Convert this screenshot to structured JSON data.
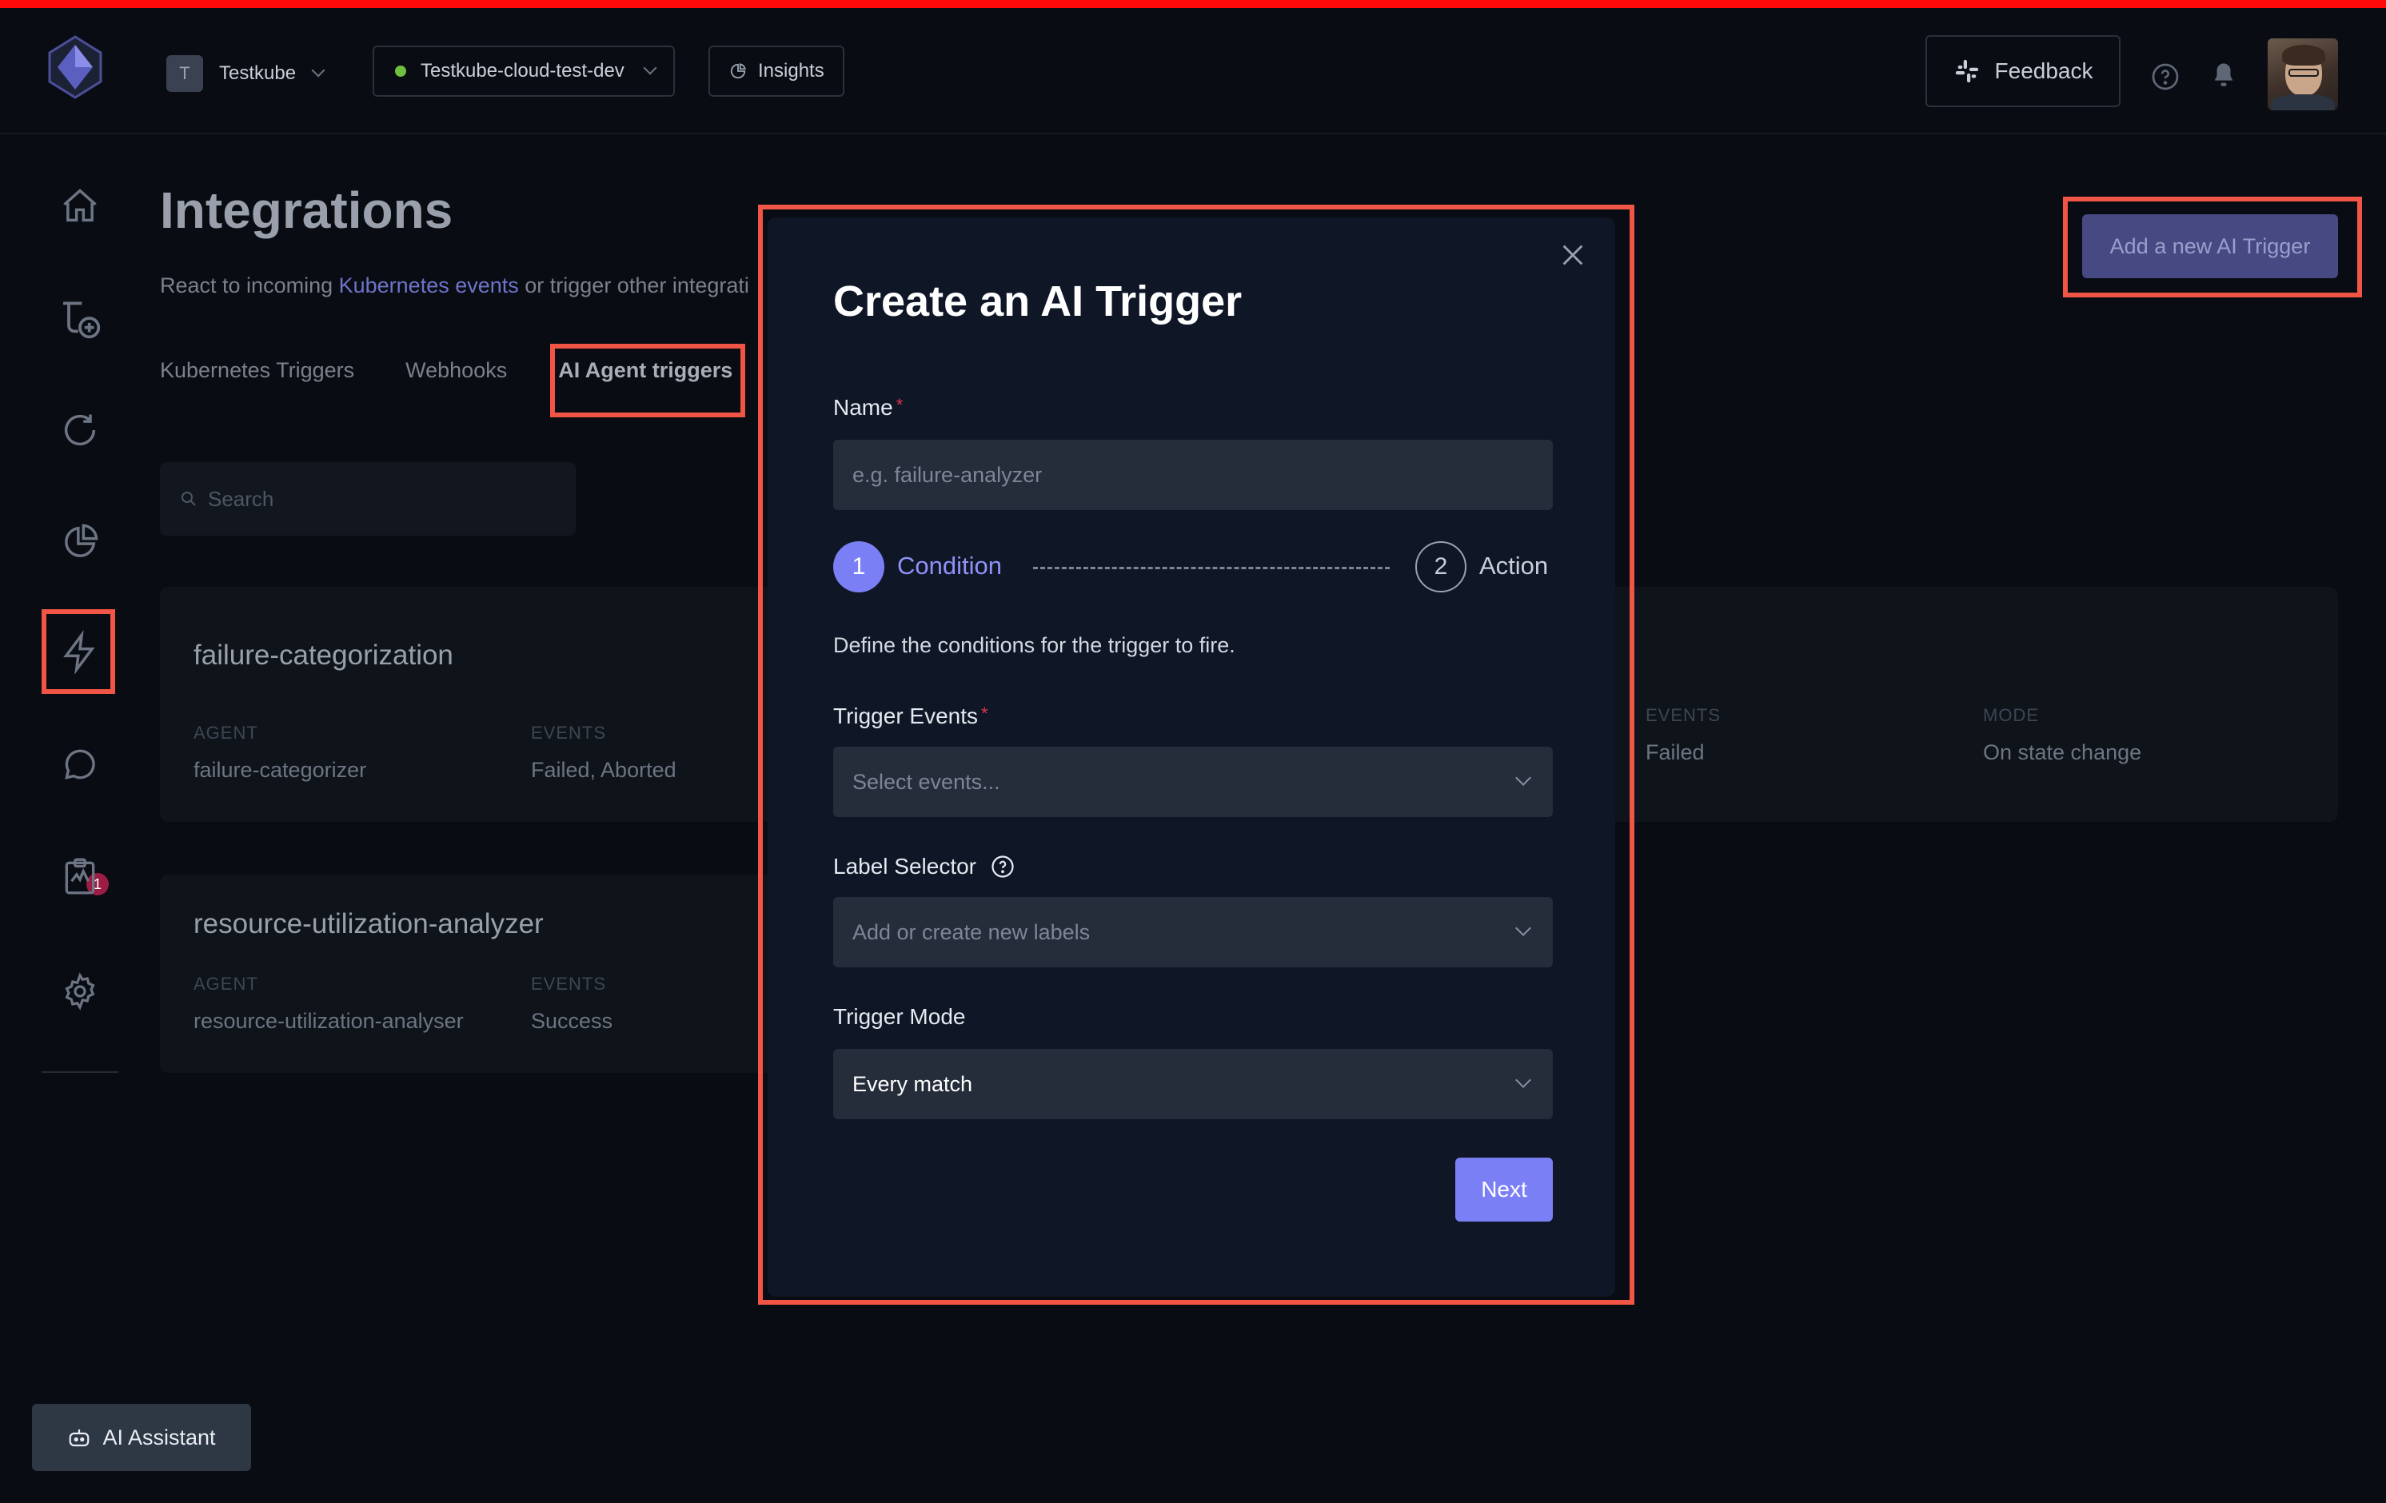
{
  "header": {
    "org": {
      "initial": "T",
      "name": "Testkube"
    },
    "environment": "Testkube-cloud-test-dev",
    "insights_label": "Insights",
    "feedback_label": "Feedback"
  },
  "sidebar": {
    "items": [
      {
        "icon": "home-icon"
      },
      {
        "icon": "add-workflow-icon"
      },
      {
        "icon": "refresh-icon"
      },
      {
        "icon": "pie-chart-icon"
      },
      {
        "icon": "lightning-icon",
        "active": true
      },
      {
        "icon": "chat-icon",
        "badge": "1"
      },
      {
        "icon": "clipboard-chart-icon"
      },
      {
        "icon": "gear-icon"
      }
    ]
  },
  "page": {
    "title": "Integrations",
    "description_prefix": "React to incoming ",
    "description_link": "Kubernetes events",
    "description_suffix": " or trigger other integrati",
    "tabs": [
      "Kubernetes Triggers",
      "Webhooks",
      "AI Agent triggers"
    ],
    "search_placeholder": "Search",
    "add_button": "Add a new AI Trigger",
    "cards": [
      {
        "name": "failure-categorization",
        "agent_label": "AGENT",
        "agent": "failure-categorizer",
        "events_label": "EVENTS",
        "events": "Failed, Aborted",
        "events2_label": "EVENTS",
        "events2": "Failed",
        "mode_label": "MODE",
        "mode": "On state change"
      },
      {
        "name": "resource-utilization-analyzer",
        "agent_label": "AGENT",
        "agent": "resource-utilization-analyser",
        "events_label": "EVENTS",
        "events": "Success"
      }
    ],
    "ai_assistant": "AI Assistant"
  },
  "modal": {
    "title": "Create an AI Trigger",
    "name_label": "Name",
    "name_placeholder": "e.g. failure-analyzer",
    "required_mark": "*",
    "steps": [
      {
        "number": "1",
        "label": "Condition",
        "active": true
      },
      {
        "number": "2",
        "label": "Action",
        "active": false
      }
    ],
    "description": "Define the conditions for the trigger to fire.",
    "trigger_events_label": "Trigger Events",
    "trigger_events_placeholder": "Select events...",
    "label_selector_label": "Label Selector",
    "label_selector_placeholder": "Add or create new labels",
    "trigger_mode_label": "Trigger Mode",
    "trigger_mode_value": "Every match",
    "next_button": "Next"
  },
  "colors": {
    "accent": "#7b7ff5",
    "highlight": "#f05545",
    "background": "#090c12",
    "modal": "#0f1626"
  }
}
